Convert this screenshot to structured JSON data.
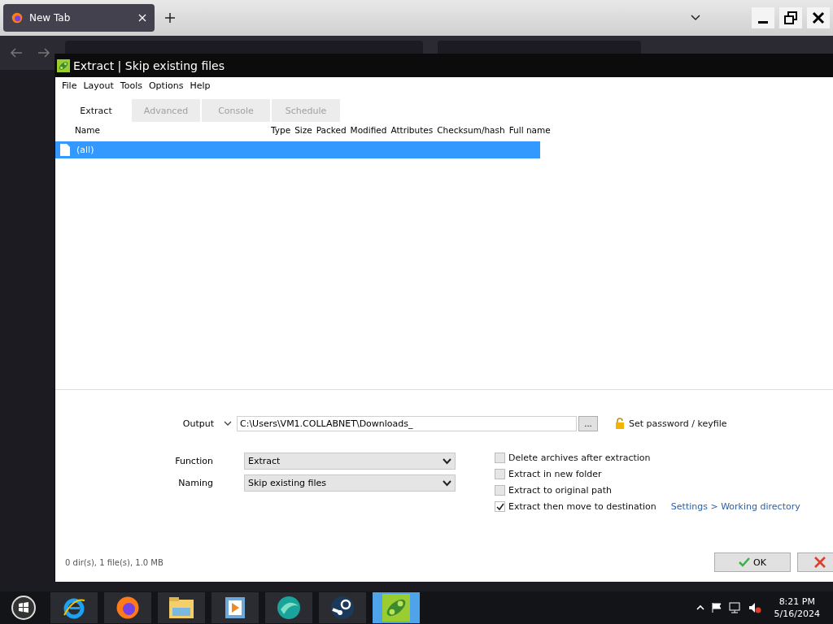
{
  "browser": {
    "tabs": [
      {
        "title": "New Tab",
        "selected": true
      }
    ]
  },
  "dialog": {
    "title": "Extract | Skip existing files",
    "menu": [
      "File",
      "Layout",
      "Tools",
      "Options",
      "Help"
    ],
    "tabs": [
      {
        "label": "Extract",
        "selected": true
      },
      {
        "label": "Advanced",
        "selected": false
      },
      {
        "label": "Console",
        "selected": false
      },
      {
        "label": "Schedule",
        "selected": false
      }
    ],
    "columns": [
      "Name",
      "Type",
      "Size",
      "Packed",
      "Modified",
      "Attributes",
      "Checksum/hash",
      "Full name"
    ],
    "rows": [
      {
        "name": "(all)",
        "selected": true
      }
    ],
    "output": {
      "label": "Output",
      "value": "C:\\Users\\VM1.COLLABNET\\Downloads_",
      "browse": "...",
      "password_link": "Set password / keyfile"
    },
    "selects": [
      {
        "label": "Function",
        "value": "Extract"
      },
      {
        "label": "Naming",
        "value": "Skip existing files"
      }
    ],
    "options": [
      {
        "label": "Delete archives after extraction",
        "checked": false
      },
      {
        "label": "Extract in new folder",
        "checked": false
      },
      {
        "label": "Extract to original path",
        "checked": false
      },
      {
        "label": "Extract then move to destination",
        "checked": true
      }
    ],
    "settings_link": "Settings > Working directory",
    "status": "0 dir(s), 1 file(s), 1.0 MB",
    "buttons": [
      {
        "kind": "ok",
        "label": "OK"
      },
      {
        "kind": "cancel"
      }
    ]
  },
  "taskbar": {
    "apps": [
      {
        "kind": "ie",
        "selected": false
      },
      {
        "kind": "firefox",
        "selected": false
      },
      {
        "kind": "folder",
        "selected": false
      },
      {
        "kind": "media",
        "selected": false
      },
      {
        "kind": "globe",
        "selected": false
      },
      {
        "kind": "steam",
        "selected": false
      },
      {
        "kind": "pea",
        "selected": true
      }
    ],
    "time": "8:21 PM",
    "date": "5/16/2024"
  }
}
